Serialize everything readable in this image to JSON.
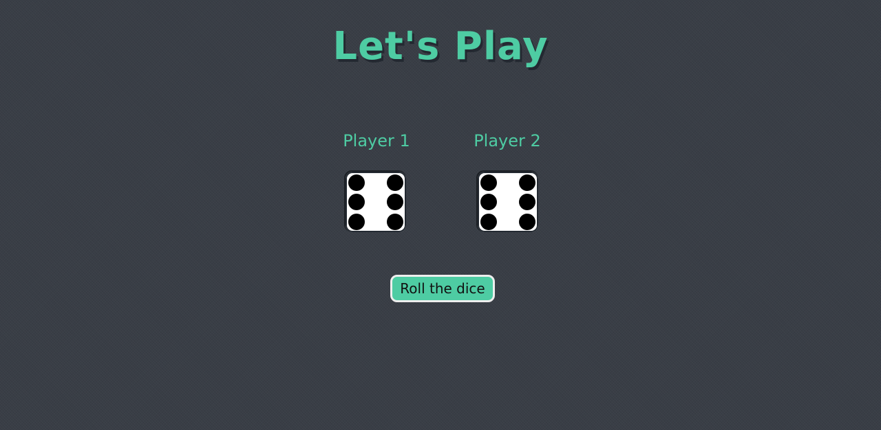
{
  "title": "Let's Play",
  "players": [
    {
      "label": "Player 1",
      "die_value": 6
    },
    {
      "label": "Player 2",
      "die_value": 6
    }
  ],
  "roll_button_label": "Roll the dice",
  "colors": {
    "background": "#393e46",
    "accent": "#4ecca3",
    "die_face": "#ffffff",
    "pip": "#000000"
  }
}
